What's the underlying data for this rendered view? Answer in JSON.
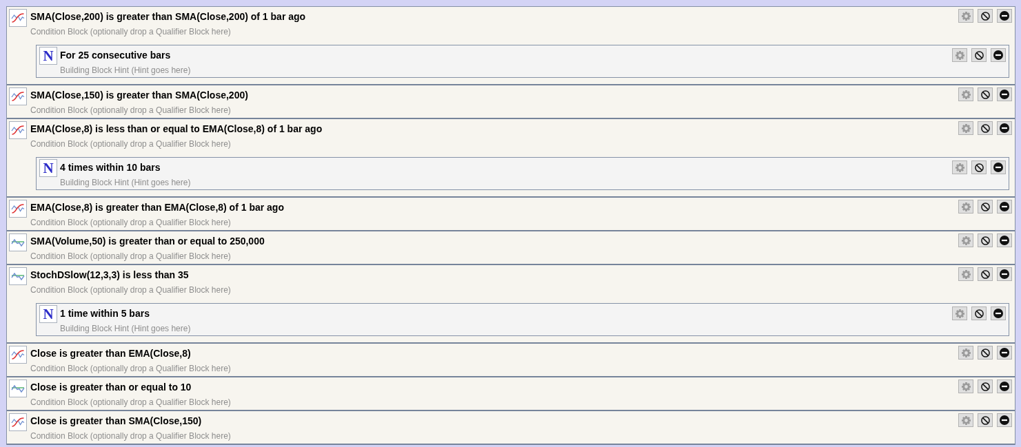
{
  "conditions": [
    {
      "kind": "crossover",
      "title": "SMA(Close,200) is greater than SMA(Close,200) of 1 bar ago",
      "hint": "Condition Block (optionally drop a Qualifier Block here)",
      "qualifiers": [
        {
          "badge": "N",
          "title": "For 25 consecutive bars",
          "hint": "Building Block Hint (Hint goes here)"
        }
      ]
    },
    {
      "kind": "crossover",
      "title": "SMA(Close,150) is greater than SMA(Close,200)",
      "hint": "Condition Block (optionally drop a Qualifier Block here)"
    },
    {
      "kind": "crossover",
      "title": "EMA(Close,8) is less than or equal to EMA(Close,8) of 1 bar ago",
      "hint": "Condition Block (optionally drop a Qualifier Block here)",
      "qualifiers": [
        {
          "badge": "N",
          "title": "4 times within 10 bars",
          "hint": "Building Block Hint (Hint goes here)"
        }
      ]
    },
    {
      "kind": "crossover",
      "title": "EMA(Close,8) is greater than EMA(Close,8) of 1 bar ago",
      "hint": "Condition Block (optionally drop a Qualifier Block here)"
    },
    {
      "kind": "threshold",
      "title": "SMA(Volume,50) is greater than or equal to 250,000",
      "hint": "Condition Block (optionally drop a Qualifier Block here)"
    },
    {
      "kind": "threshold",
      "title": "StochDSlow(12,3,3) is less than 35",
      "hint": "Condition Block (optionally drop a Qualifier Block here)",
      "qualifiers": [
        {
          "badge": "N",
          "title": "1 time within 5 bars",
          "hint": "Building Block Hint (Hint goes here)"
        }
      ]
    },
    {
      "kind": "crossover",
      "title": "Close is greater than EMA(Close,8)",
      "hint": "Condition Block (optionally drop a Qualifier Block here)"
    },
    {
      "kind": "threshold",
      "title": "Close is greater than or equal to 10",
      "hint": "Condition Block (optionally drop a Qualifier Block here)"
    },
    {
      "kind": "crossover",
      "title": "Close is greater than SMA(Close,150)",
      "hint": "Condition Block (optionally drop a Qualifier Block here)"
    }
  ]
}
